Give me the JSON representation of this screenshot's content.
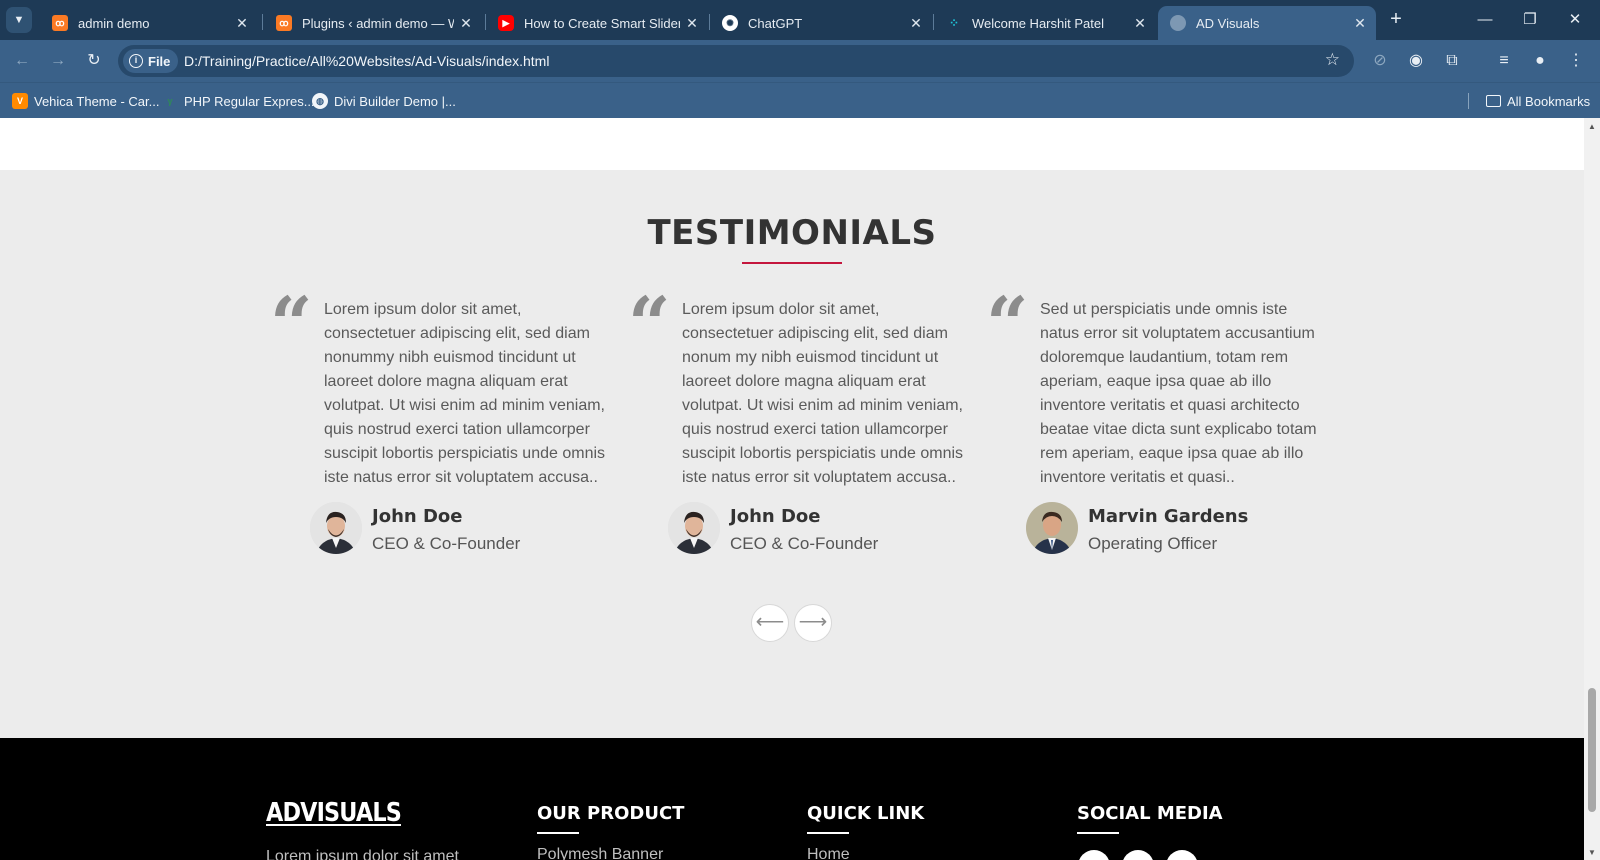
{
  "browser": {
    "tabs": [
      {
        "title": "admin demo",
        "icon": "xampp-icon",
        "color": "#fb7a24",
        "active": false
      },
      {
        "title": "Plugins ‹ admin demo — Wo",
        "icon": "xampp-icon",
        "color": "#fb7a24",
        "active": false
      },
      {
        "title": "How to Create Smart Slider in",
        "icon": "youtube-icon",
        "color": "#ff0000",
        "active": false
      },
      {
        "title": "ChatGPT",
        "icon": "chatgpt-icon",
        "color": "#ffffff",
        "active": false
      },
      {
        "title": "Welcome Harshit Patel",
        "icon": "dots-logo-icon",
        "color": "#1ec6d8",
        "active": false
      },
      {
        "title": "AD Visuals",
        "icon": "globe-icon",
        "color": "#7d98b3",
        "active": true
      }
    ],
    "address": {
      "scheme_label": "File",
      "url": "D:/Training/Practice/All%20Websites/Ad-Visuals/index.html"
    },
    "bookmarks": [
      {
        "title": "Vehica Theme - Car...",
        "icon": "vehica-icon"
      },
      {
        "title": "PHP Regular Expres...",
        "icon": "php-icon"
      },
      {
        "title": "Divi Builder Demo |...",
        "icon": "globe-icon"
      }
    ],
    "all_bookmarks_label": "All Bookmarks"
  },
  "testimonials": {
    "title": "TESTIMONIALS",
    "accent_color": "#c4163d",
    "items": [
      {
        "text": "Lorem ipsum dolor sit amet, consectetuer adipiscing elit, sed diam nonummy nibh euismod tincidunt ut laoreet dolore magna aliquam erat volutpat. Ut wisi enim ad minim veniam, quis nostrud exerci tation ullamcorper suscipit lobortis perspiciatis unde omnis iste natus error sit voluptatem accusa..",
        "name": "John Doe",
        "role": "CEO & Co-Founder"
      },
      {
        "text": "Lorem ipsum dolor sit amet, consectetuer adipiscing elit, sed diam nonum my nibh euismod tincidunt ut laoreet dolore magna aliquam erat volutpat. Ut wisi enim ad minim veniam, quis nostrud exerci tation ullamcorper suscipit lobortis perspiciatis unde omnis iste natus error sit voluptatem accusa..",
        "name": "John Doe",
        "role": "CEO & Co-Founder"
      },
      {
        "text": "Sed ut perspiciatis unde omnis iste natus error sit voluptatem accusantium doloremque laudantium, totam rem aperiam, eaque ipsa quae ab illo inventore veritatis et quasi architecto beatae vitae dicta sunt explicabo totam rem aperiam, eaque ipsa quae ab illo inventore veritatis et quasi..",
        "name": "Marvin Gardens",
        "role": "Operating Officer"
      }
    ],
    "prev_icon": "arrow-left-icon",
    "next_icon": "arrow-right-icon"
  },
  "footer": {
    "logo": "ADVISUALS",
    "about_text": "Lorem ipsum dolor sit amet",
    "columns": [
      {
        "heading": "OUR PRODUCT",
        "first_link": "Polymesh Banner"
      },
      {
        "heading": "QUICK LINK",
        "first_link": "Home"
      },
      {
        "heading": "SOCIAL MEDIA"
      }
    ]
  }
}
